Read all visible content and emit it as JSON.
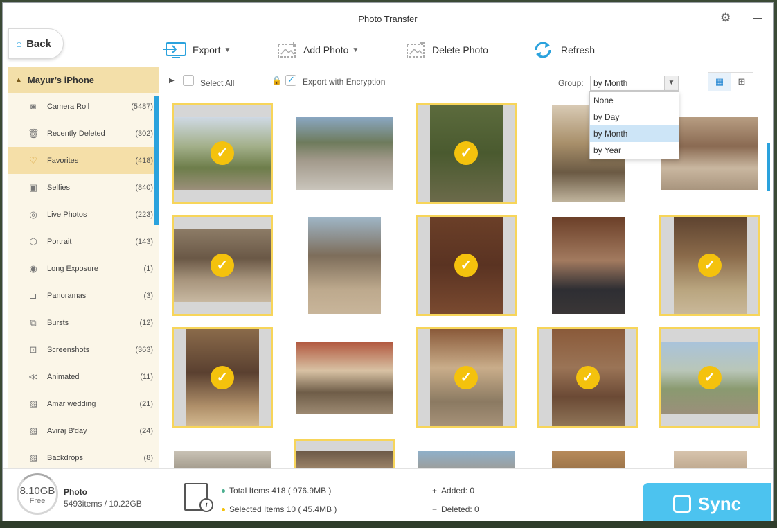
{
  "window": {
    "title": "Photo Transfer"
  },
  "nav": {
    "back_label": "Back"
  },
  "toolbar": {
    "export_label": "Export",
    "add_photo_label": "Add Photo",
    "delete_photo_label": "Delete Photo",
    "refresh_label": "Refresh"
  },
  "sidebar": {
    "device_name": "Mayur’s iPhone",
    "items": [
      {
        "label": "Camera Roll",
        "count": "(5487)",
        "icon": "camera-icon"
      },
      {
        "label": "Recently Deleted",
        "count": "(302)",
        "icon": "trash-icon"
      },
      {
        "label": "Favorites",
        "count": "(418)",
        "icon": "heart-icon"
      },
      {
        "label": "Selfies",
        "count": "(840)",
        "icon": "portrait-box-icon"
      },
      {
        "label": "Live Photos",
        "count": "(223)",
        "icon": "live-photo-icon"
      },
      {
        "label": "Portrait",
        "count": "(143)",
        "icon": "cube-icon"
      },
      {
        "label": "Long Exposure",
        "count": "(1)",
        "icon": "long-exposure-icon"
      },
      {
        "label": "Panoramas",
        "count": "(3)",
        "icon": "panorama-icon"
      },
      {
        "label": "Bursts",
        "count": "(12)",
        "icon": "bursts-icon"
      },
      {
        "label": "Screenshots",
        "count": "(363)",
        "icon": "screenshot-icon"
      },
      {
        "label": "Animated",
        "count": "(11)",
        "icon": "animated-icon"
      },
      {
        "label": "Amar wedding",
        "count": "(21)",
        "icon": "album-icon"
      },
      {
        "label": "Aviraj B'day",
        "count": "(24)",
        "icon": "album-icon"
      },
      {
        "label": "Backdrops",
        "count": "(8)",
        "icon": "album-icon"
      }
    ]
  },
  "controls": {
    "select_all_label": "Select All",
    "encryption_label": "Export with Encryption",
    "group_label": "Group:",
    "group_value": "by Month",
    "group_options": [
      "None",
      "by Day",
      "by Month",
      "by Year"
    ]
  },
  "footer": {
    "storage_free": "8.10GB",
    "storage_free_label": "Free",
    "category": "Photo",
    "category_stats": "5493items / 10.22GB",
    "total_items": "Total Items 418 ( 976.9MB )",
    "selected_items": "Selected Items 10 ( 45.4MB )",
    "added": "Added: 0",
    "deleted": "Deleted: 0",
    "sync_label": "Sync"
  },
  "colors": {
    "accent": "#2aa2dd",
    "selection": "#f7d55a",
    "check": "#f4c20d",
    "sync": "#4cc3ef"
  }
}
